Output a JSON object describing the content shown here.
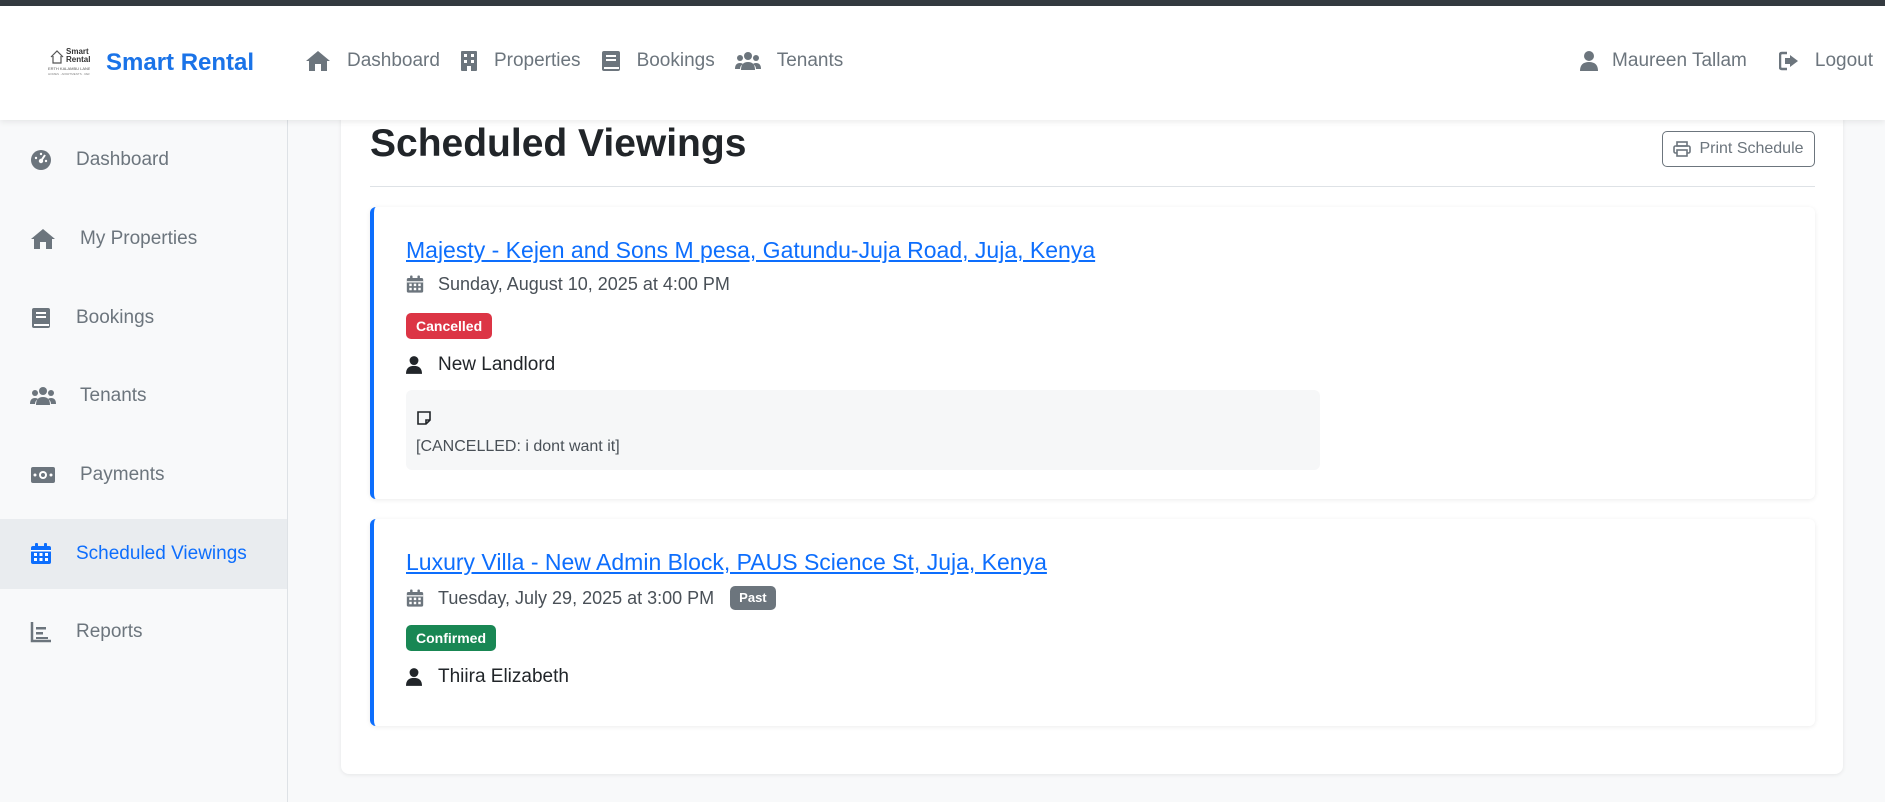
{
  "brand": {
    "logo_line1": "Smart",
    "logo_line2": "Rental",
    "logo_line3": "ERTH KALAMBU LANE",
    "logo_line4": "HOMES · APARTMENTS · RENTALS",
    "name": "Smart Rental",
    "color": "#1a73e8"
  },
  "topnav": {
    "items": [
      {
        "label": "Dashboard",
        "icon": "home-icon"
      },
      {
        "label": "Properties",
        "icon": "building-icon"
      },
      {
        "label": "Bookings",
        "icon": "book-icon"
      },
      {
        "label": "Tenants",
        "icon": "users-icon"
      }
    ],
    "user": {
      "label": "Maureen Tallam",
      "icon": "user-icon"
    },
    "logout": {
      "label": "Logout",
      "icon": "logout-icon"
    }
  },
  "sidebar": {
    "items": [
      {
        "label": "Dashboard",
        "icon": "gauge-icon"
      },
      {
        "label": "My Properties",
        "icon": "home-icon"
      },
      {
        "label": "Bookings",
        "icon": "book-icon"
      },
      {
        "label": "Tenants",
        "icon": "users-icon"
      },
      {
        "label": "Payments",
        "icon": "money-icon"
      },
      {
        "label": "Scheduled Viewings",
        "icon": "calendar-icon",
        "active": true
      },
      {
        "label": "Reports",
        "icon": "chart-icon"
      }
    ]
  },
  "page": {
    "title": "Scheduled Viewings",
    "print_label": "Print Schedule"
  },
  "viewings": [
    {
      "title": "Majesty - Kejen and Sons M pesa, Gatundu-Juja Road, Juja, Kenya",
      "date": "Sunday, August 10, 2025 at 4:00 PM",
      "status": "Cancelled",
      "status_color": "#dc3545",
      "person": "New Landlord",
      "note": "[CANCELLED: i dont want it]"
    },
    {
      "title": "Luxury Villa - New Admin Block, PAUS Science St, Juja, Kenya",
      "date": "Tuesday, July 29, 2025 at 3:00 PM",
      "date_badge": "Past",
      "status": "Confirmed",
      "status_color": "#198754",
      "person": "Thiira Elizabeth"
    }
  ],
  "colors": {
    "accent": "#0d6efd",
    "muted": "#6c757d",
    "danger": "#dc3545",
    "success": "#198754"
  }
}
